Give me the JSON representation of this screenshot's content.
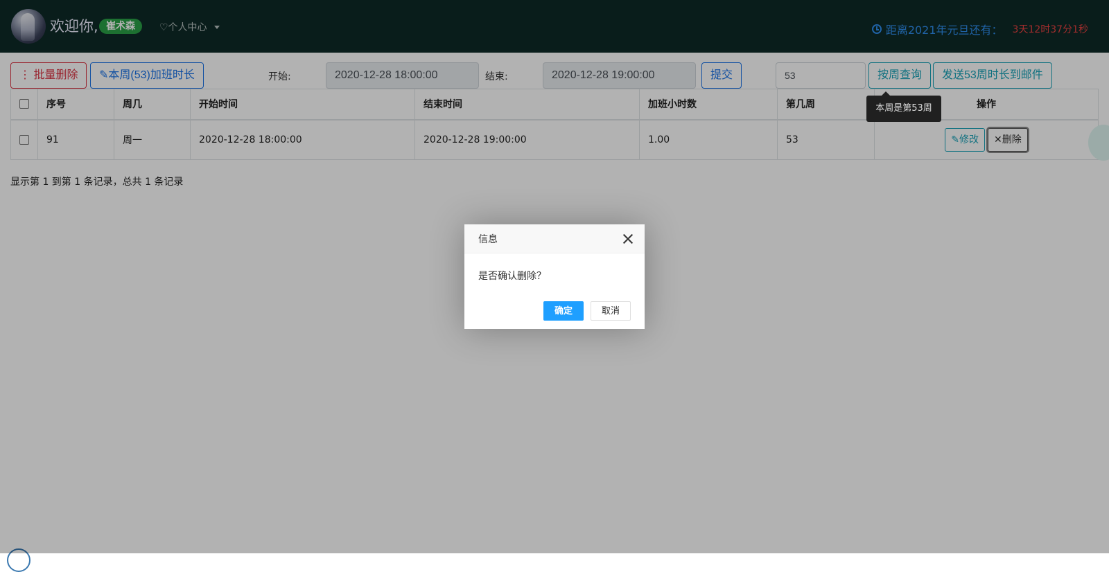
{
  "header": {
    "welcome": "欢迎你,",
    "username": "崔术森",
    "personal_center": "♡个人中心",
    "countdown_label": "距离2021年元旦还有：",
    "countdown_value": "3天12时37分1秒"
  },
  "toolbar": {
    "batch_delete": "⋮ 批量删除",
    "week_overtime": "本周(53)加班时长",
    "start_label": "开始:",
    "start_value": "2020-12-28 18:00:00",
    "end_label": "结束:",
    "end_value": "2020-12-28 19:00:00",
    "submit": "提交",
    "week_value": "53",
    "query_by_week": "按周查询",
    "send_email": "发送53周时长到邮件",
    "tooltip": "本周是第53周"
  },
  "table": {
    "headers": [
      "序号",
      "周几",
      "开始时间",
      "结束时间",
      "加班小时数",
      "第几周",
      "操作"
    ],
    "rows": [
      {
        "id": "91",
        "weekday": "周一",
        "start": "2020-12-28 18:00:00",
        "end": "2020-12-28 19:00:00",
        "hours": "1.00",
        "week": "53",
        "edit": "修改",
        "delete": "删除"
      }
    ],
    "pagination_info": "显示第 1 到第 1 条记录，总共 1 条记录"
  },
  "modal": {
    "title": "信息",
    "message": "是否确认删除？",
    "ok": "确定",
    "cancel": "取消"
  }
}
